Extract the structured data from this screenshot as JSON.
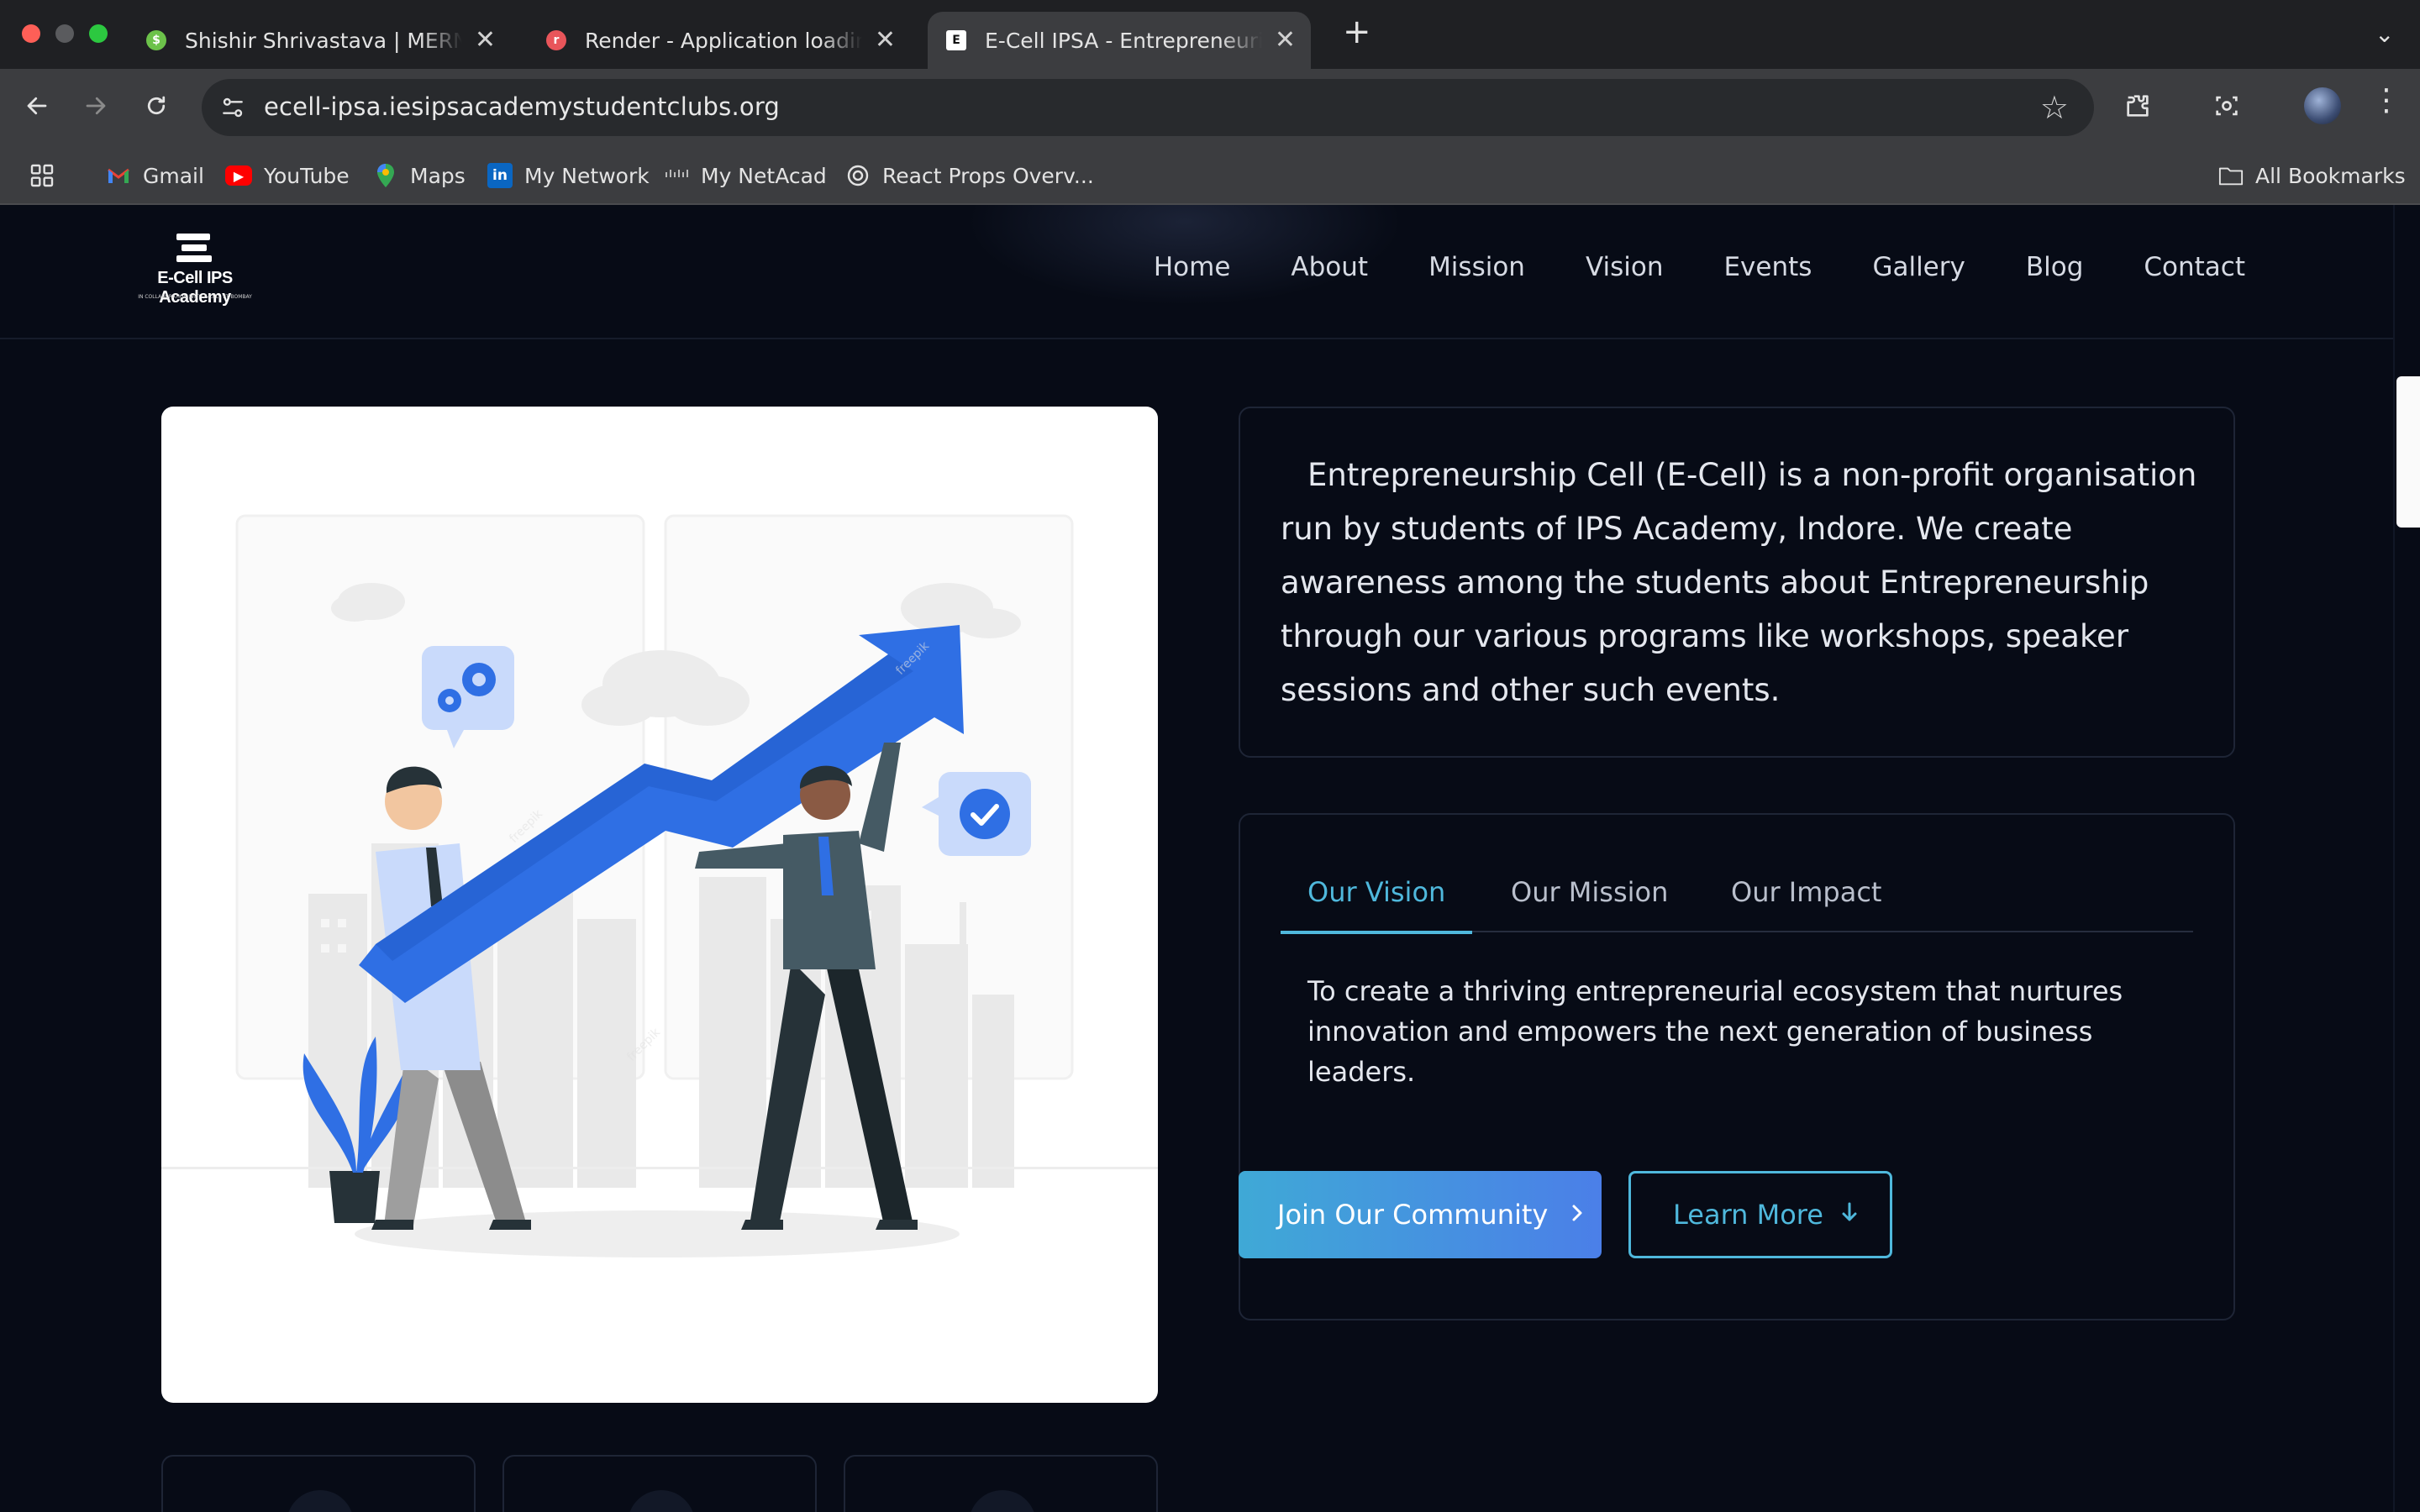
{
  "browser": {
    "tabs": [
      {
        "title": "Shishir Shrivastava | MERN St",
        "favicon_color": "#6cc24a",
        "active": false
      },
      {
        "title": "Render - Application loading",
        "favicon_color": "#e8555a",
        "active": false
      },
      {
        "title": "E-Cell IPSA - Entrepreneurial",
        "favicon_color": "#ffffff",
        "active": true
      }
    ],
    "new_tab_icon": "+",
    "url": "ecell-ipsa.iesipsacademystudentclubs.org",
    "bookmarks": [
      {
        "label": "Gmail",
        "icon": "gmail-icon"
      },
      {
        "label": "YouTube",
        "icon": "youtube-icon"
      },
      {
        "label": "Maps",
        "icon": "maps-icon"
      },
      {
        "label": "My Network",
        "icon": "linkedin-icon"
      },
      {
        "label": "My NetAcad",
        "icon": "cisco-icon"
      },
      {
        "label": "React Props Overv...",
        "icon": "openai-icon"
      }
    ],
    "all_bookmarks_label": "All Bookmarks"
  },
  "site": {
    "logo": {
      "name": "E-Cell IPS Academy",
      "tagline": "IN COLLABORATION WITH E-CELL IIT BOMBAY"
    },
    "nav": [
      "Home",
      "About",
      "Mission",
      "Vision",
      "Events",
      "Gallery",
      "Blog",
      "Contact"
    ],
    "about_text": "Entrepreneurship Cell (E-Cell) is a non-profit organisation run by students of IPS Academy, Indore. We create awareness among the students about Entrepreneurship through our various programs like workshops, speaker sessions and other such events.",
    "tabs": [
      "Our Vision",
      "Our Mission",
      "Our Impact"
    ],
    "active_tab": "Our Vision",
    "tab_content": "To create a thriving entrepreneurial ecosystem that nurtures innovation and empowers the next generation of business leaders.",
    "primary_button": "Join Our Community",
    "secondary_button": "Learn More",
    "accent_color": "#4fb8dc",
    "gradient": [
      "#3fa9d6",
      "#4b7fe8"
    ]
  }
}
